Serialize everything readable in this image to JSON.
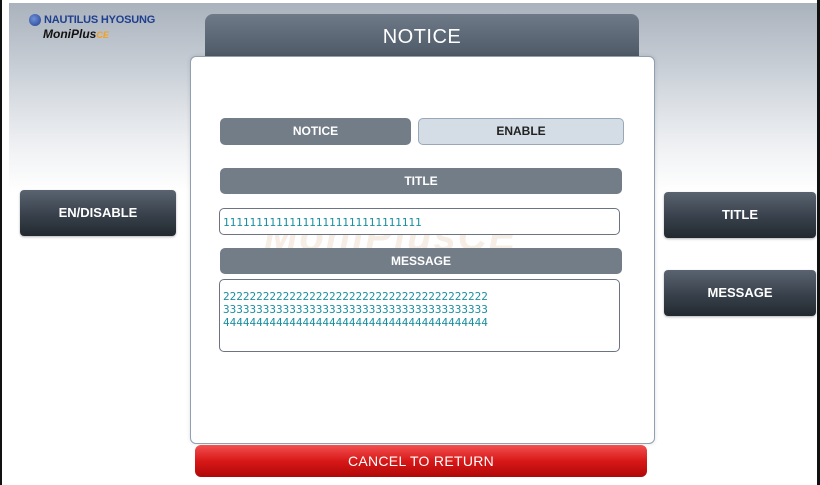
{
  "logo": {
    "brand": "NAUTILUS HYOSUNG",
    "product": "MoniPlus",
    "product_suffix": "CE"
  },
  "screen": {
    "title": "NOTICE",
    "watermark": "MoniPlusCE"
  },
  "toggle": {
    "notice_label": "NOTICE",
    "enable_label": "ENABLE"
  },
  "title_section": {
    "label": "TITLE",
    "value": "111111111111111111111111111111"
  },
  "message_section": {
    "label": "MESSAGE",
    "lines": [
      "2222222222222222222222222222222222222222",
      "3333333333333333333333333333333333333333",
      "4444444444444444444444444444444444444444"
    ]
  },
  "side_buttons": {
    "en_disable": "EN/DISABLE",
    "title": "TITLE",
    "message": "MESSAGE"
  },
  "footer": {
    "cancel": "CANCEL TO RETURN"
  },
  "colors": {
    "accent_red": "#d81818",
    "bar_gray": "#737d87",
    "text_teal": "#1a8fa0"
  }
}
